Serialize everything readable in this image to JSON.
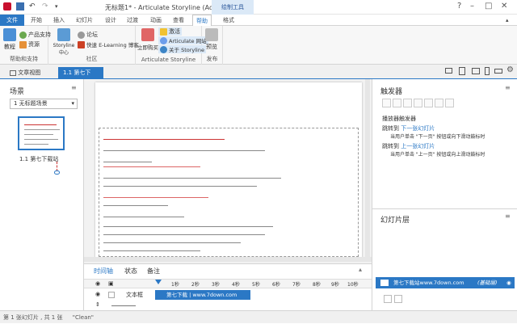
{
  "window": {
    "title": "无标题1* - Articulate Storyline (Administrator)",
    "contextual_tab": "绘制工具"
  },
  "tabs": [
    "文件",
    "开始",
    "插入",
    "幻灯片",
    "设计",
    "过渡",
    "动画",
    "查看",
    "帮助",
    "格式"
  ],
  "ribbon": {
    "group1": {
      "label": "帮助和支持",
      "tutorial": "教程",
      "product_support": "产品支持",
      "resources": "资源"
    },
    "group2": {
      "label": "社区",
      "storyline_center": "Storyline 中心",
      "forum": "论坛",
      "quick_elearning": "快速 E-Learning 博客"
    },
    "group3": {
      "label": "Articulate Storyline",
      "buy_now": "立即购买",
      "activate": "激活",
      "articulate_site": "Articulate 网站",
      "about": "关于 Storyline"
    },
    "group4": {
      "label": "发布",
      "preview": "预览"
    }
  },
  "docbar": {
    "story_view": "文章视图",
    "active_tab": "1.1 第七下载..."
  },
  "scenes": {
    "title": "场景",
    "dropdown": "1 无标题场景",
    "slide_label": "1.1 第七下载站"
  },
  "triggers": {
    "title": "触发器",
    "section": "播放器触发器",
    "t1_jump": "跳转到",
    "t1_link": "下一张幻灯片",
    "t1_cond": "当用户单击 \"下一页\" 按钮或向下滑动鼓标时",
    "t2_jump": "跳转到",
    "t2_link": "上一张幻灯片",
    "t2_cond": "当用户单击 \"上一页\" 按钮或向上滑动鼓标时"
  },
  "layers": {
    "title": "幻灯片层",
    "base_layer": "第七下载站www.7down.com",
    "base_tag": "(基础层)"
  },
  "timeline": {
    "tabs": [
      "时间轴",
      "状态",
      "备注"
    ],
    "ticks": [
      "1秒",
      "2秒",
      "3秒",
      "4秒",
      "5秒",
      "6秒",
      "7秒",
      "8秒",
      "9秒",
      "10秒"
    ],
    "row_label": "文本框",
    "row_bar": "第七下载 | www.7down.com"
  },
  "status": {
    "slide_info": "第 1 张幻灯片 , 共 1 张",
    "theme": "\"Clean\""
  },
  "colors": {
    "accent": "#2b78c5",
    "ribbon_bg": "#f7f7f7",
    "layer_selected": "#2b78c5"
  }
}
